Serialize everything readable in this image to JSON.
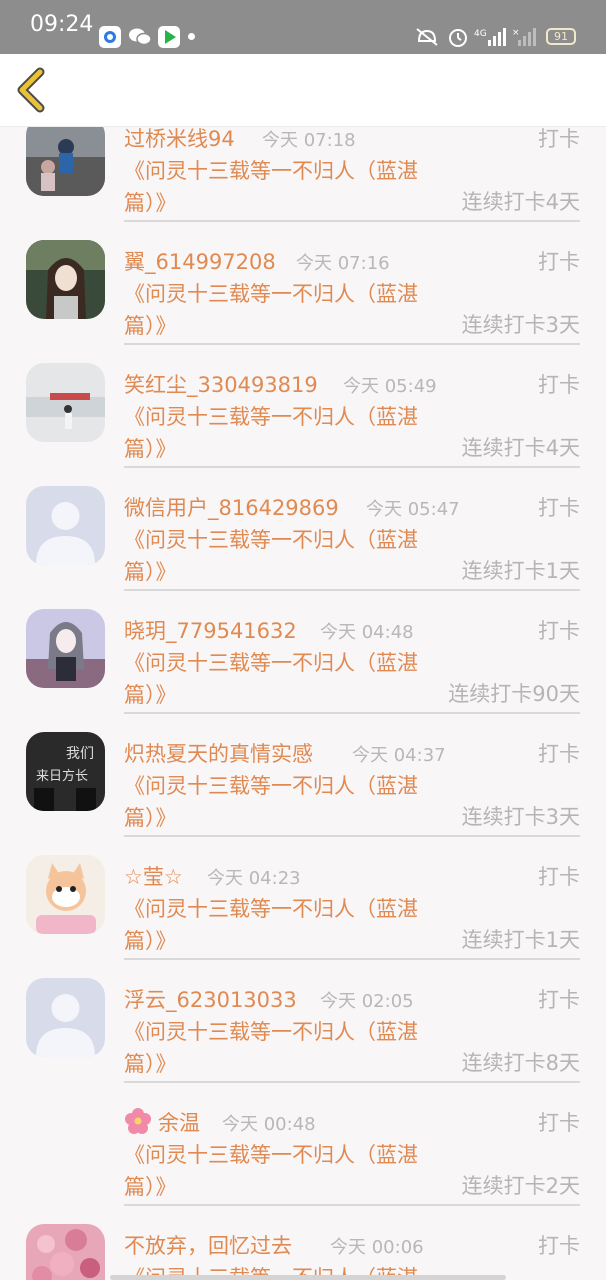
{
  "status_bar": {
    "time": "09:24",
    "network": "4G",
    "battery": "91"
  },
  "header": {
    "back_icon": "chevron-left-icon",
    "accent": "#e9c235"
  },
  "colors": {
    "name": "#e08a52",
    "muted": "#b5b5b5",
    "background": "#f8f6f7"
  },
  "items": [
    {
      "name": "过桥米线94",
      "time": "今天 07:18",
      "action": "打卡",
      "book": "《问灵十三载等一不归人（蓝湛篇）》",
      "streak": "连续打卡4天",
      "avatar": "photo-avatar"
    },
    {
      "name": "翼_614997208",
      "time": "今天 07:16",
      "action": "打卡",
      "book": "《问灵十三载等一不归人（蓝湛篇）》",
      "streak": "连续打卡3天",
      "avatar": "photo-avatar"
    },
    {
      "name": "笑红尘_330493819",
      "time": "今天 05:49",
      "action": "打卡",
      "book": "《问灵十三载等一不归人（蓝湛篇）》",
      "streak": "连续打卡4天",
      "avatar": "photo-avatar"
    },
    {
      "name": "微信用户_816429869",
      "time": "今天 05:47",
      "action": "打卡",
      "book": "《问灵十三载等一不归人（蓝湛篇）》",
      "streak": "连续打卡1天",
      "avatar": "default-avatar"
    },
    {
      "name": "晓玥_779541632",
      "time": "今天 04:48",
      "action": "打卡",
      "book": "《问灵十三载等一不归人（蓝湛篇）》",
      "streak": "连续打卡90天",
      "avatar": "photo-avatar"
    },
    {
      "name": "炽热夏天的真情实感",
      "time": "今天 04:37",
      "action": "打卡",
      "book": "《问灵十三载等一不归人（蓝湛篇）》",
      "streak": "连续打卡3天",
      "avatar": "photo-avatar"
    },
    {
      "name": "☆莹☆",
      "time": "今天 04:23",
      "action": "打卡",
      "book": "《问灵十三载等一不归人（蓝湛篇）》",
      "streak": "连续打卡1天",
      "avatar": "photo-avatar"
    },
    {
      "name": "浮云_623013033",
      "time": "今天 02:05",
      "action": "打卡",
      "book": "《问灵十三载等一不归人（蓝湛篇）》",
      "streak": "连续打卡8天",
      "avatar": "default-avatar"
    },
    {
      "name": "余温",
      "time": "今天 00:48",
      "action": "打卡",
      "book": "《问灵十三载等一不归人（蓝湛篇）》",
      "streak": "连续打卡2天",
      "avatar": "blank-avatar",
      "name_icon": "flower-icon"
    },
    {
      "name": "不放弃，回忆过去",
      "time": "今天 00:06",
      "action": "打卡",
      "book": "《问灵十三载等一不归人（蓝湛篇）》",
      "streak": "",
      "avatar": "photo-avatar"
    }
  ]
}
